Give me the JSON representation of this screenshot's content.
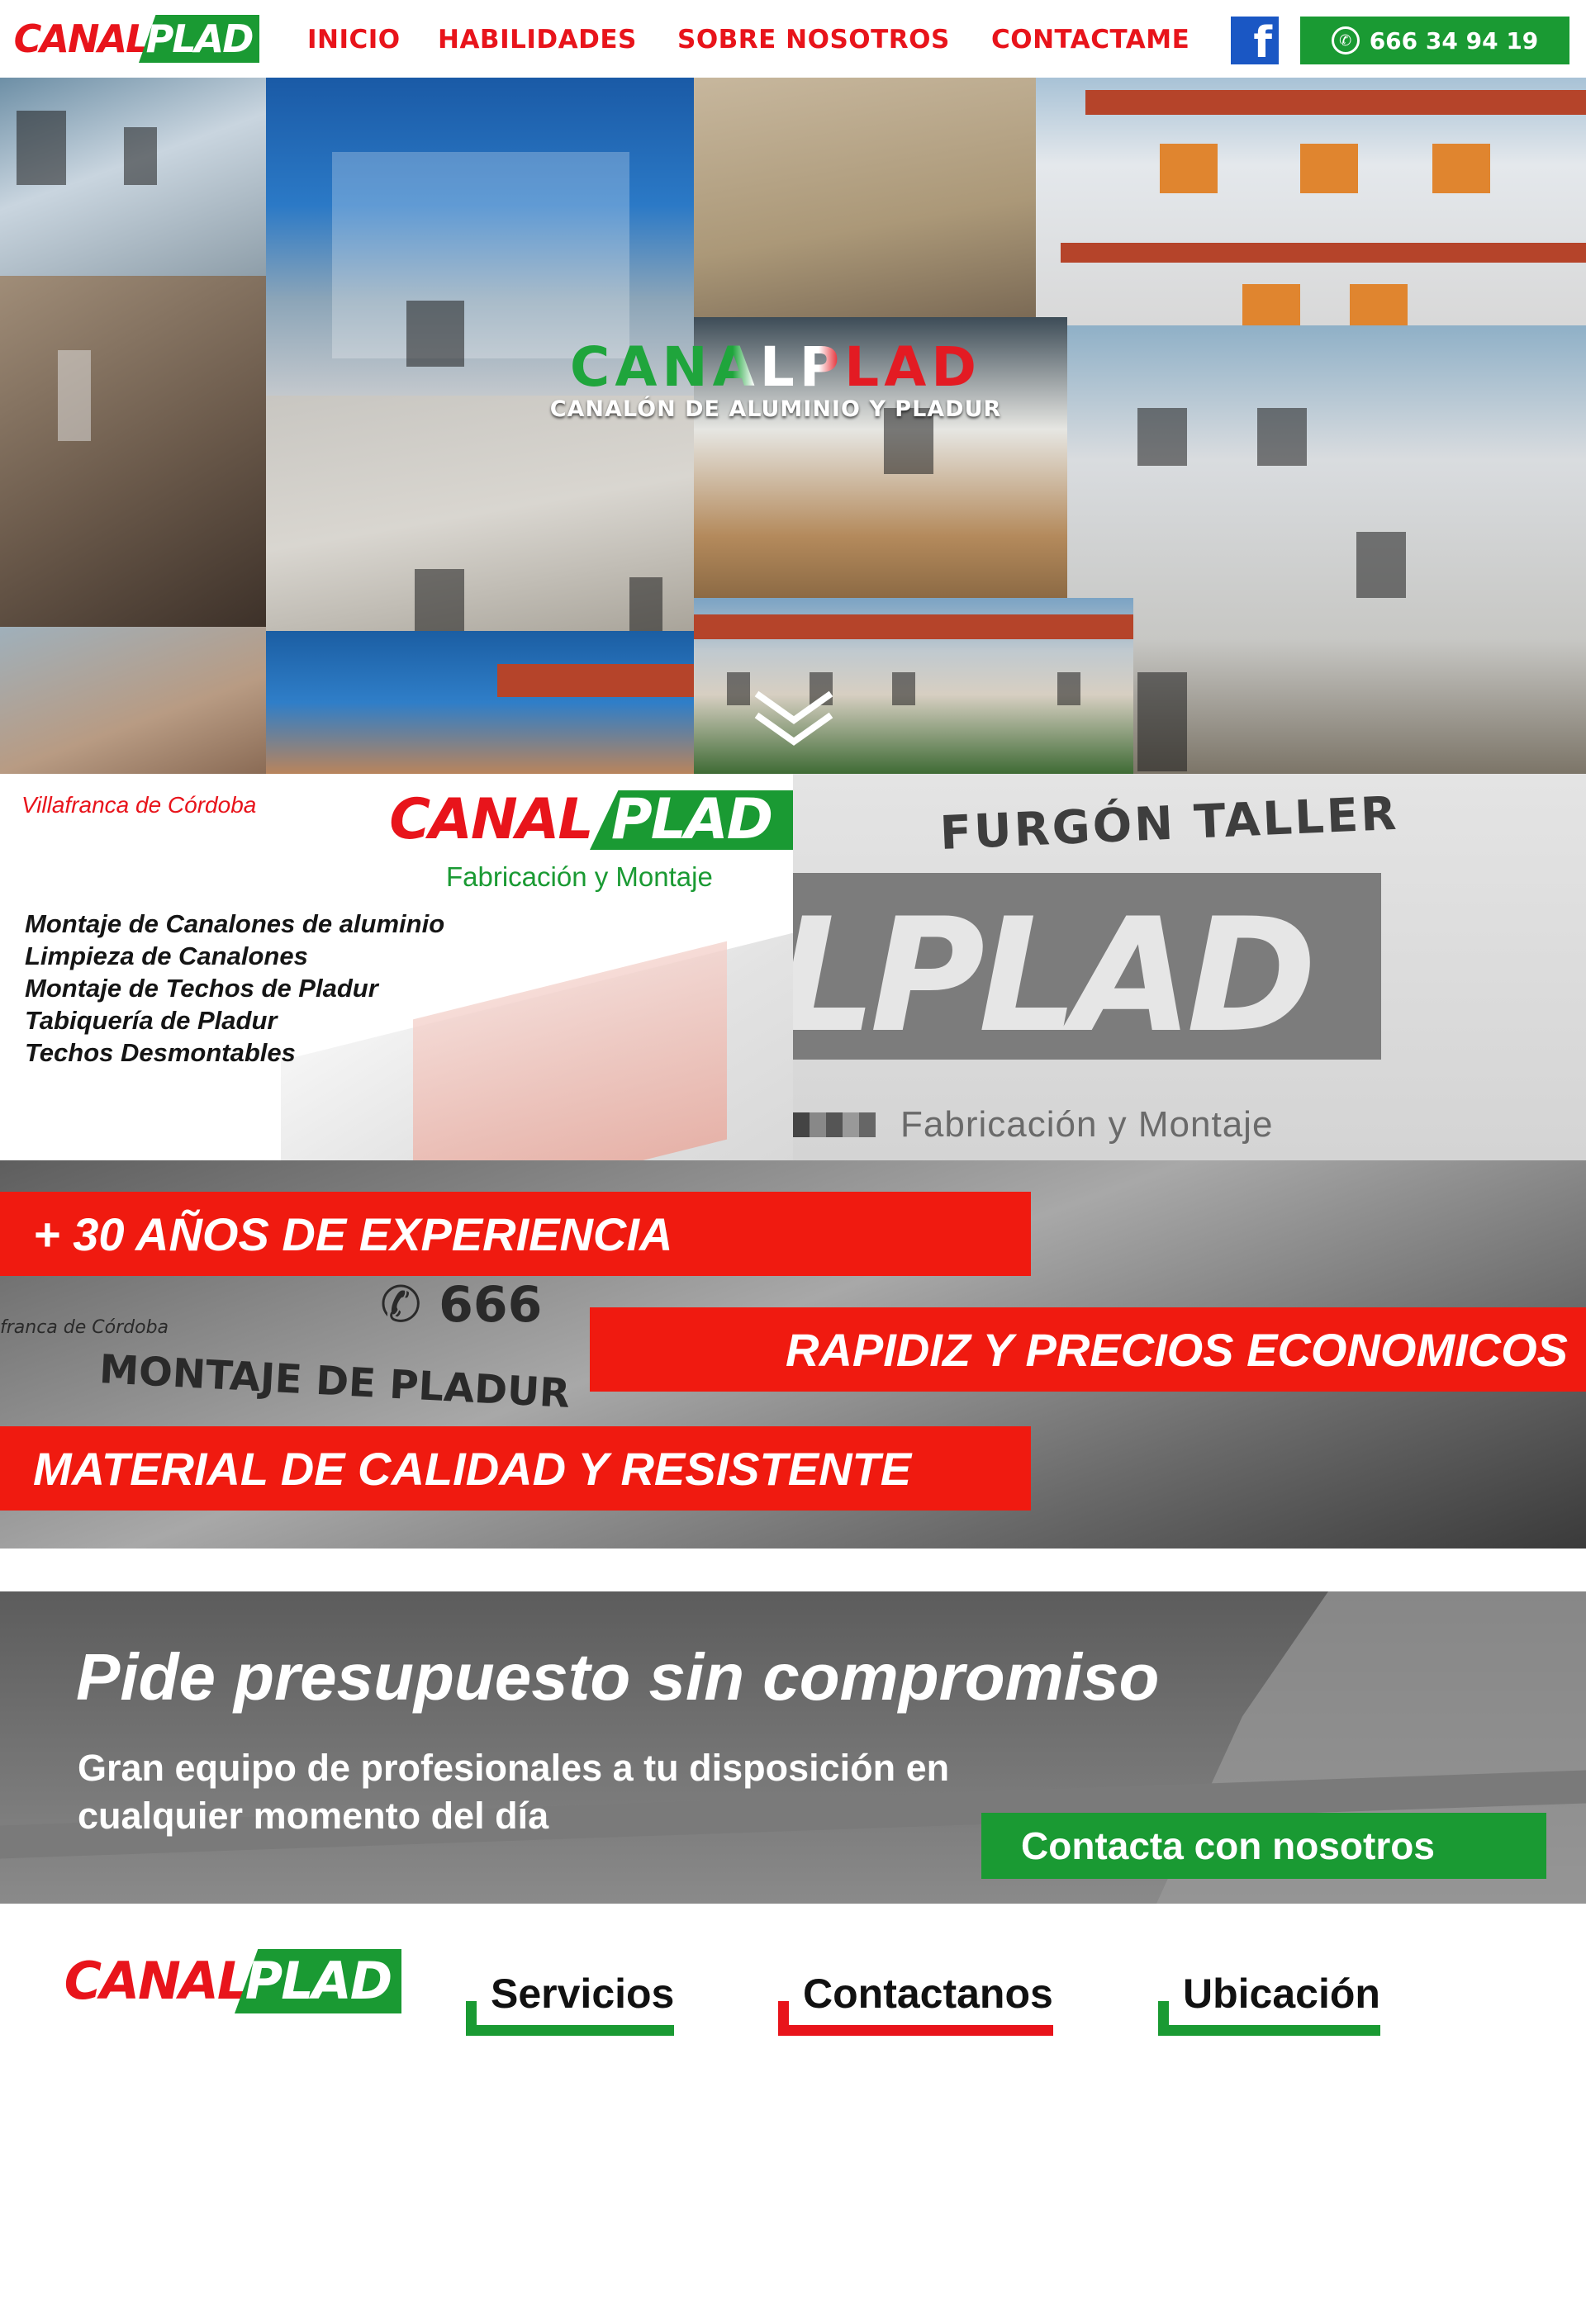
{
  "nav": {
    "logo_left": "CANAL",
    "logo_right": "PLAD",
    "menu": [
      "INICIO",
      "HABILIDADES",
      "SOBRE NOSOTROS",
      "CONTACTAME"
    ],
    "facebook_icon": "facebook-icon",
    "whatsapp_icon": "whatsapp-icon",
    "phone": "666 34 94 19"
  },
  "hero": {
    "brand": "CANALPLAD",
    "subtitle": "CANALÓN DE ALUMINIO Y PLADUR",
    "scroll_icon": "double-chevron-down-icon"
  },
  "intro": {
    "location": "Villafranca de Córdoba",
    "logo_left": "CANAL",
    "logo_right": "PLAD",
    "tagline": "Fabricación y Montaje",
    "services": [
      "Montaje de Canalones de aluminio",
      "Limpieza de Canalones",
      "Montaje de Techos de Pladur",
      "Tabiquería de Pladur",
      "Techos Desmontables"
    ],
    "van_title": "FURGÓN TALLER",
    "van_word": "LPLAD",
    "van_sub": "Fabricación y Montaje"
  },
  "features": {
    "banner1": "+ 30 AÑOS DE EXPERIENCIA",
    "banner2": "RAPIDIZ Y PRECIOS ECONOMICOS",
    "banner3": "MATERIAL DE CALIDAD Y RESISTENTE",
    "van_phone": "666",
    "van_town": "franca de Córdoba",
    "van_text": "MONTAJE DE PLADUR"
  },
  "cta": {
    "title": "Pide presupuesto sin compromiso",
    "text": "Gran equipo de profesionales a tu disposición en cualquier momento del día",
    "button": "Contacta con nosotros"
  },
  "footer": {
    "logo_left": "CANAL",
    "logo_right": "PLAD",
    "links": [
      "Servicios",
      "Contactanos",
      "Ubicación"
    ]
  },
  "colors": {
    "brand_red": "#e8141b",
    "brand_green": "#1a9a33",
    "banner_red": "#f01a10",
    "facebook_blue": "#1a57c4"
  }
}
